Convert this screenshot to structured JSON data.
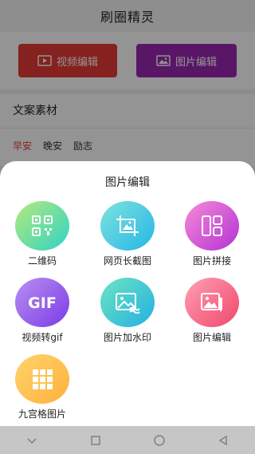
{
  "header": {
    "title": "刷圈精灵"
  },
  "buttons": {
    "video_edit": "视频编辑",
    "image_edit": "图片编辑"
  },
  "section": {
    "title": "文案素材",
    "tabs": [
      "早安",
      "晚安",
      "励志"
    ],
    "active_tab": "早安"
  },
  "sheet": {
    "title": "图片编辑",
    "items": [
      {
        "label": "二维码",
        "icon": "qr-code-icon"
      },
      {
        "label": "网页长截图",
        "icon": "crop-image-icon"
      },
      {
        "label": "图片拼接",
        "icon": "layout-collage-icon"
      },
      {
        "label": "视频转gif",
        "icon": "gif-icon"
      },
      {
        "label": "图片加水印",
        "icon": "watermark-image-icon"
      },
      {
        "label": "图片编辑",
        "icon": "edit-image-icon"
      },
      {
        "label": "九宫格图片",
        "icon": "nine-grid-icon"
      }
    ]
  },
  "navbar": {
    "icons": [
      "back-chevron-icon",
      "home-square-icon",
      "home-circle-icon",
      "back-triangle-icon"
    ]
  },
  "colors": {
    "video_btn": "#e53935",
    "image_btn": "#9c27b0",
    "active_tab": "#e53935",
    "qr": [
      "#b5ea7a",
      "#2fd3c7"
    ],
    "screenshot": [
      "#7fe3df",
      "#25b6e6"
    ],
    "collage": [
      "#f58ad8",
      "#b532d4"
    ],
    "gif": [
      "#b98ff2",
      "#7b3be6"
    ],
    "watermark": [
      "#6ee3c1",
      "#22b1e2"
    ],
    "edit": [
      "#ff9fb4",
      "#f0476b"
    ],
    "nine_grid": [
      "#ffd36b",
      "#ffb13d"
    ]
  }
}
